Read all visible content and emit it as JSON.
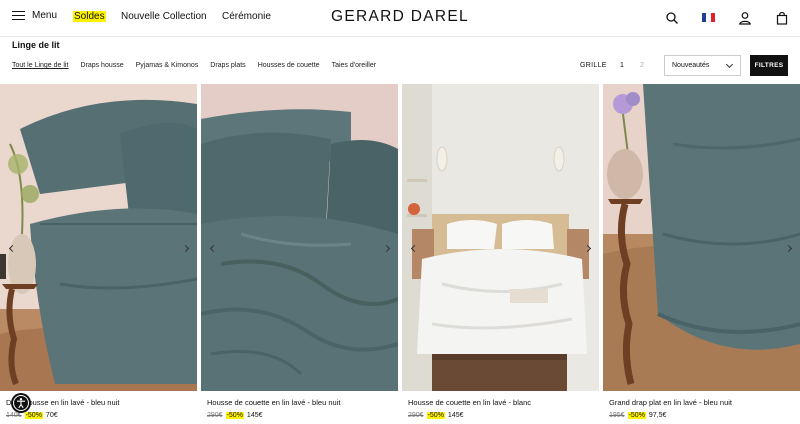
{
  "header": {
    "menu_label": "Menu",
    "nav": {
      "soldes": "Soldes",
      "new": "Nouvelle Collection",
      "ceremonie": "Cérémonie"
    },
    "logo": "GERARD DAREL",
    "icons": [
      "search-icon",
      "french-flag-icon",
      "account-icon",
      "bag-icon"
    ],
    "highlight_color": "#fff200"
  },
  "category": {
    "title": "Linge de lit",
    "filters": [
      "Tout le Linge de lit",
      "Draps housse",
      "Pyjamas & Kimonos",
      "Draps plats",
      "Housses de couette",
      "Taies d'oreiller"
    ],
    "grid_label": "GRILLE",
    "grid_options": [
      "1",
      "2"
    ],
    "sort_value": "Nouveautés",
    "filters_button": "FILTRES"
  },
  "products": [
    {
      "name": "Drap housse en lin lavé - bleu nuit",
      "old_price": "140€",
      "discount": "-50%",
      "price": "70€"
    },
    {
      "name": "Housse de couette en lin lavé - bleu nuit",
      "old_price": "290€",
      "discount": "-50%",
      "price": "145€"
    },
    {
      "name": "Housse de couette en lin lavé - blanc",
      "old_price": "290€",
      "discount": "-50%",
      "price": "145€"
    },
    {
      "name": "Grand drap plat en lin lavé - bleu nuit",
      "old_price": "195€",
      "discount": "-50%",
      "price": "97,5€"
    }
  ]
}
